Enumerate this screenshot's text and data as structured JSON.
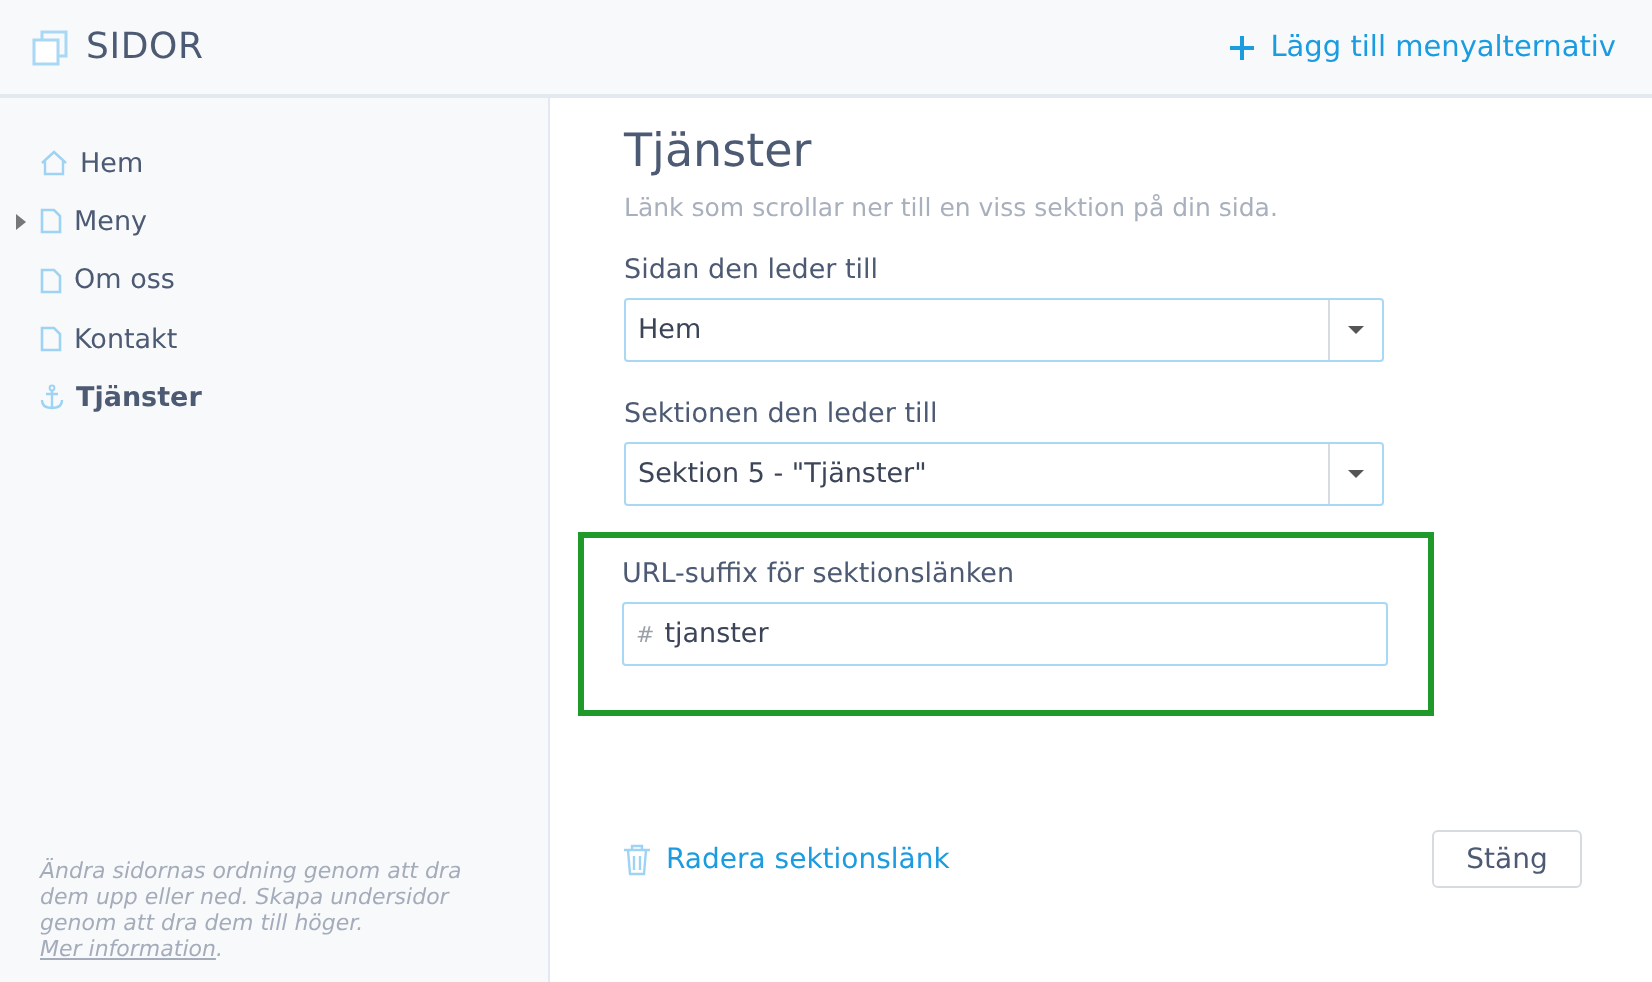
{
  "header": {
    "title": "SIDOR",
    "action": "Lägg till menyalternativ"
  },
  "sidebar": {
    "items": [
      {
        "label": "Hem",
        "kind": "home",
        "selected": false
      },
      {
        "label": "Meny",
        "kind": "page",
        "selected": false,
        "expanded": false
      },
      {
        "label": "Om oss",
        "kind": "page",
        "selected": false
      },
      {
        "label": "Kontakt",
        "kind": "page",
        "selected": false
      },
      {
        "label": "Tjänster",
        "kind": "anchor",
        "selected": true
      }
    ],
    "hint": "Ändra sidornas ordning genom att dra dem upp eller ned. Skapa undersidor genom att dra dem till höger.",
    "hint_link": "Mer information",
    "hint_end": "."
  },
  "panel": {
    "title": "Tjänster",
    "subtitle": "Länk som scrollar ner till en viss sektion på din sida.",
    "fields": [
      {
        "kind": "select",
        "label": "Sidan den leder till",
        "value": "Hem",
        "highlighted": false
      },
      {
        "kind": "select",
        "label": "Sektionen den leder till",
        "value": "Sektion 5 - \"Tjänster\"",
        "highlighted": false
      },
      {
        "kind": "text",
        "label": "URL-suffix för sektionslänken",
        "prefix": "#",
        "value": "tjanster",
        "highlighted": true
      }
    ],
    "delete_link": "Radera sektionslänk",
    "close_button": "Stäng"
  }
}
